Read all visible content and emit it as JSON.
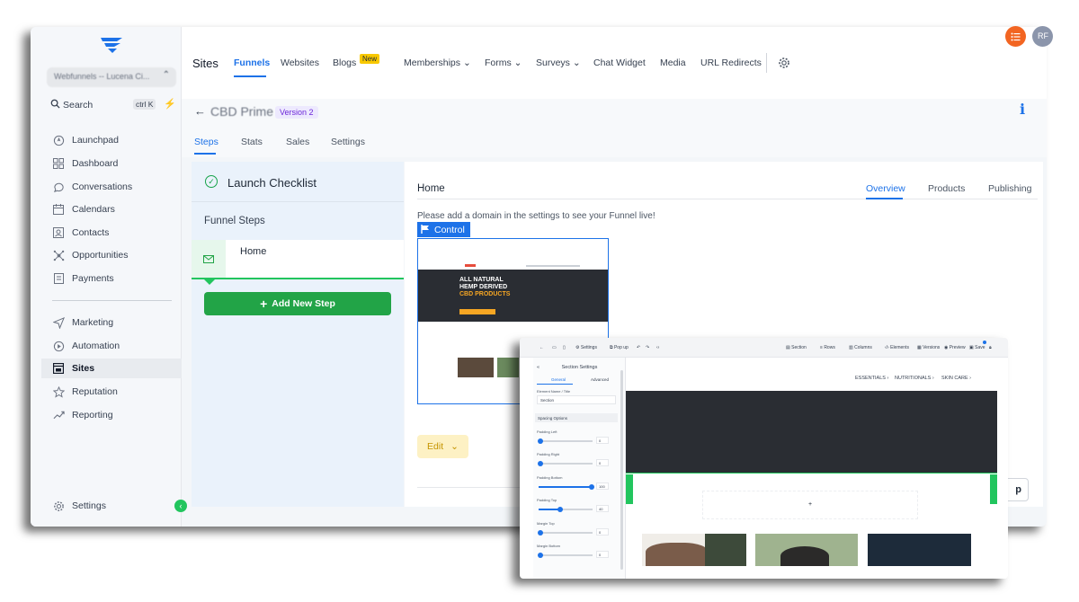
{
  "sidebar": {
    "account": "Webfunnels -- Lucena Ci...",
    "search_label": "Search",
    "search_shortcut": "ctrl K",
    "items_top": [
      {
        "label": "Launchpad",
        "icon": "rocket-icon"
      },
      {
        "label": "Dashboard",
        "icon": "grid-icon"
      },
      {
        "label": "Conversations",
        "icon": "chat-bubble-icon"
      },
      {
        "label": "Calendars",
        "icon": "calendar-icon"
      },
      {
        "label": "Contacts",
        "icon": "contact-card-icon"
      },
      {
        "label": "Opportunities",
        "icon": "network-icon"
      },
      {
        "label": "Payments",
        "icon": "receipt-icon"
      }
    ],
    "items_bottom": [
      {
        "label": "Marketing",
        "icon": "send-icon"
      },
      {
        "label": "Automation",
        "icon": "automation-icon"
      },
      {
        "label": "Sites",
        "icon": "window-icon",
        "active": true
      },
      {
        "label": "Reputation",
        "icon": "star-icon"
      },
      {
        "label": "Reporting",
        "icon": "trend-icon"
      }
    ],
    "settings_label": "Settings"
  },
  "topbar": {
    "title": "Sites",
    "nav": [
      "Funnels",
      "Websites",
      "Blogs",
      "Memberships",
      "Forms",
      "Surveys",
      "Chat Widget",
      "Media",
      "URL Redirects"
    ],
    "new_badge": "New",
    "avatar_initials": "RF"
  },
  "funnel": {
    "name": "CBD Prime",
    "version": "Version 2",
    "tabs": [
      "Steps",
      "Stats",
      "Sales",
      "Settings"
    ]
  },
  "left_panel": {
    "checklist": "Launch Checklist",
    "steps_label": "Funnel Steps",
    "step_name": "Home",
    "add_step": "Add New Step"
  },
  "right_panel": {
    "title": "Home",
    "tabs": [
      "Overview",
      "Products",
      "Publishing"
    ],
    "note": "Please add a domain in the settings to see your Funnel live!",
    "control": "Control",
    "edit": "Edit",
    "partial_button": "p"
  },
  "thumbnail": {
    "hero_line1": "ALL NATURAL",
    "hero_line2": "HEMP DERIVED",
    "hero_line3": "CBD PRODUCTS"
  },
  "builder": {
    "toolbar": [
      "Settings",
      "Pop up",
      "Section",
      "Rows",
      "Columns",
      "Elements",
      "Versions",
      "Preview",
      "Save"
    ],
    "panel_title": "Section Settings",
    "panel_tabs": [
      "General",
      "Advanced"
    ],
    "element_name_label": "Element Name / Title",
    "element_name_value": "Section",
    "spacing_label": "Spacing Options",
    "sliders": [
      {
        "label": "Padding Left",
        "value": "0",
        "fraction": 0.0
      },
      {
        "label": "Padding Right",
        "value": "0",
        "fraction": 0.0
      },
      {
        "label": "Padding Bottom",
        "value": "100",
        "fraction": 1.0
      },
      {
        "label": "Padding Top",
        "value": "40",
        "fraction": 0.4
      },
      {
        "label": "Margin Top",
        "value": "0",
        "fraction": 0.0
      },
      {
        "label": "Margin Bottom",
        "value": "0",
        "fraction": 0.0
      }
    ],
    "canvas_nav": [
      "ESSENTIALS ›",
      "NUTRITIONALS ›",
      "SKIN CARE ›"
    ],
    "add_symbol": "+"
  },
  "colors": {
    "accent": "#1d72e8",
    "success": "#22c55e",
    "warning": "#f8c800",
    "brand_orange": "#f26522"
  }
}
